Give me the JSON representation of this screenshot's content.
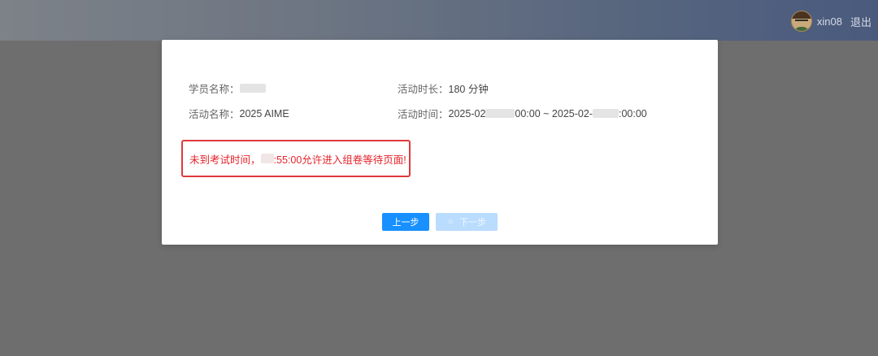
{
  "header": {
    "username": "xin08",
    "logout_label": "退出",
    "avatar_icon": "user-avatar-icon"
  },
  "modal": {
    "student_name_label": "学员名称：",
    "activity_duration_label": "活动时长：",
    "activity_duration_value": "180 分钟",
    "activity_name_label": "活动名称：",
    "activity_name_value": "2025 AIME",
    "activity_time_label": "活动时间：",
    "activity_time_start_prefix": "2025-02",
    "activity_time_start_suffix": "00:00",
    "activity_time_separator": " ~ ",
    "activity_time_end_prefix": "2025-02-",
    "activity_time_end_suffix": ":00:00",
    "notice_prefix": "未到考试时间，",
    "notice_suffix": ":55:00允许进入组卷等待页面!",
    "prev_button_label": "上一步",
    "next_button_label": "下一步",
    "next_button_icon": "loading-icon"
  },
  "colors": {
    "primary": "#1890ff",
    "primary_disabled": "#b9dcff",
    "error": "#e4242b",
    "overlay": "#7f7f7f"
  }
}
